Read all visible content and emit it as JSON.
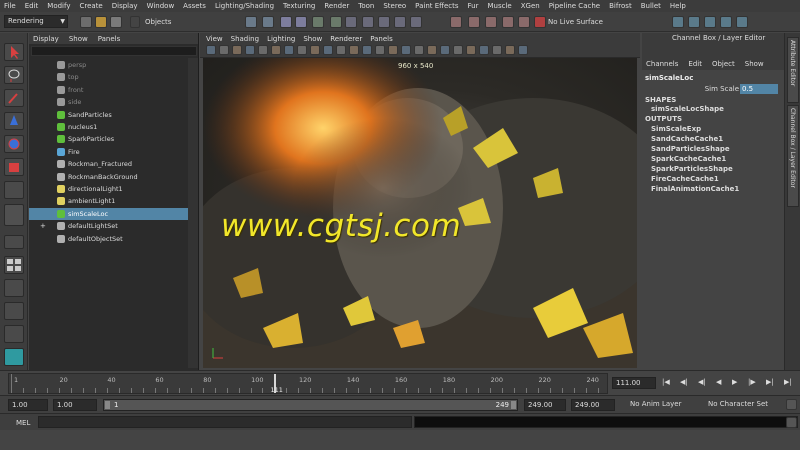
{
  "menubar": [
    "File",
    "Edit",
    "Modify",
    "Create",
    "Display",
    "Window",
    "Assets",
    "Lighting/Shading",
    "Texturing",
    "Render",
    "Toon",
    "Stereo",
    "Paint Effects",
    "Fur",
    "Muscle",
    "XGen",
    "Pipeline Cache",
    "Bifrost",
    "Bullet",
    "Help"
  ],
  "status": {
    "menuset": "Rendering",
    "objects_label": "Objects",
    "live_surface": "No Live Surface"
  },
  "outliner": {
    "menu": [
      "Display",
      "Show",
      "Panels"
    ],
    "items": [
      {
        "label": "persp",
        "dim": true,
        "icon": "camera-icon",
        "color": "#9a9a9a"
      },
      {
        "label": "top",
        "dim": true,
        "icon": "camera-icon",
        "color": "#9a9a9a"
      },
      {
        "label": "front",
        "dim": true,
        "icon": "camera-icon",
        "color": "#9a9a9a"
      },
      {
        "label": "side",
        "dim": true,
        "icon": "camera-icon",
        "color": "#9a9a9a"
      },
      {
        "label": "SandParticles",
        "dim": false,
        "icon": "particle-icon",
        "color": "#5fbf3c"
      },
      {
        "label": "nucleus1",
        "dim": false,
        "icon": "nucleus-icon",
        "color": "#5fbf3c"
      },
      {
        "label": "SparkParticles",
        "dim": false,
        "icon": "particle-icon",
        "color": "#5fbf3c"
      },
      {
        "label": "Fire",
        "dim": false,
        "icon": "fluid-icon",
        "color": "#5aa6d6"
      },
      {
        "label": "Rockman_Fractured",
        "dim": false,
        "icon": "mesh-icon",
        "color": "#b0b0b0"
      },
      {
        "label": "RockmanBackGround",
        "dim": false,
        "icon": "mesh-icon",
        "color": "#b0b0b0"
      },
      {
        "label": "directionalLight1",
        "dim": false,
        "icon": "directional-light-icon",
        "color": "#e0d060"
      },
      {
        "label": "ambientLight1",
        "dim": false,
        "icon": "ambient-light-icon",
        "color": "#e0d060"
      },
      {
        "label": "simScaleLoc",
        "dim": false,
        "icon": "locator-icon",
        "color": "#5fbf3c",
        "selected": true
      },
      {
        "label": "defaultLightSet",
        "dim": false,
        "icon": "set-icon",
        "color": "#b0b0b0",
        "expand": true
      },
      {
        "label": "defaultObjectSet",
        "dim": false,
        "icon": "set-icon",
        "color": "#b0b0b0"
      }
    ]
  },
  "viewport": {
    "menu": [
      "View",
      "Shading",
      "Lighting",
      "Show",
      "Renderer",
      "Panels"
    ],
    "resolution": "960 x 540",
    "watermark": "www.cgtsj.com"
  },
  "channelbox": {
    "title": "Channel Box / Layer Editor",
    "menu": [
      "Channels",
      "Edit",
      "Object",
      "Show"
    ],
    "object": "simScaleLoc",
    "attr_label": "Sim Scale",
    "attr_value": "0.5",
    "shapes_header": "SHAPES",
    "shapes": [
      "simScaleLocShape"
    ],
    "outputs_header": "OUTPUTS",
    "outputs": [
      "SimScaleExp",
      "SandCacheCache1",
      "SandParticlesShape",
      "SparkCacheCache1",
      "SparkParticlesShape",
      "FireCacheCache1",
      "FinalAnimationCache1"
    ],
    "side_tabs": [
      "Attribute Editor",
      "Channel Box / Layer Editor"
    ]
  },
  "timeline": {
    "start": 1,
    "end": 249,
    "labels": [
      "1",
      "20",
      "40",
      "60",
      "80",
      "100",
      "120",
      "140",
      "160",
      "180",
      "200",
      "220",
      "240"
    ],
    "current": "111",
    "current_field": "111.00"
  },
  "range": {
    "start": "1.00",
    "anim_start": "1.00",
    "slider_start": "1",
    "slider_end": "249",
    "end": "249.00",
    "anim_end": "249.00",
    "anim_layer": "No Anim Layer",
    "character_set": "No Character Set"
  },
  "command": {
    "label": "MEL"
  },
  "colors": {
    "selection": "#5285a6",
    "watermark": "#f2e72a"
  }
}
